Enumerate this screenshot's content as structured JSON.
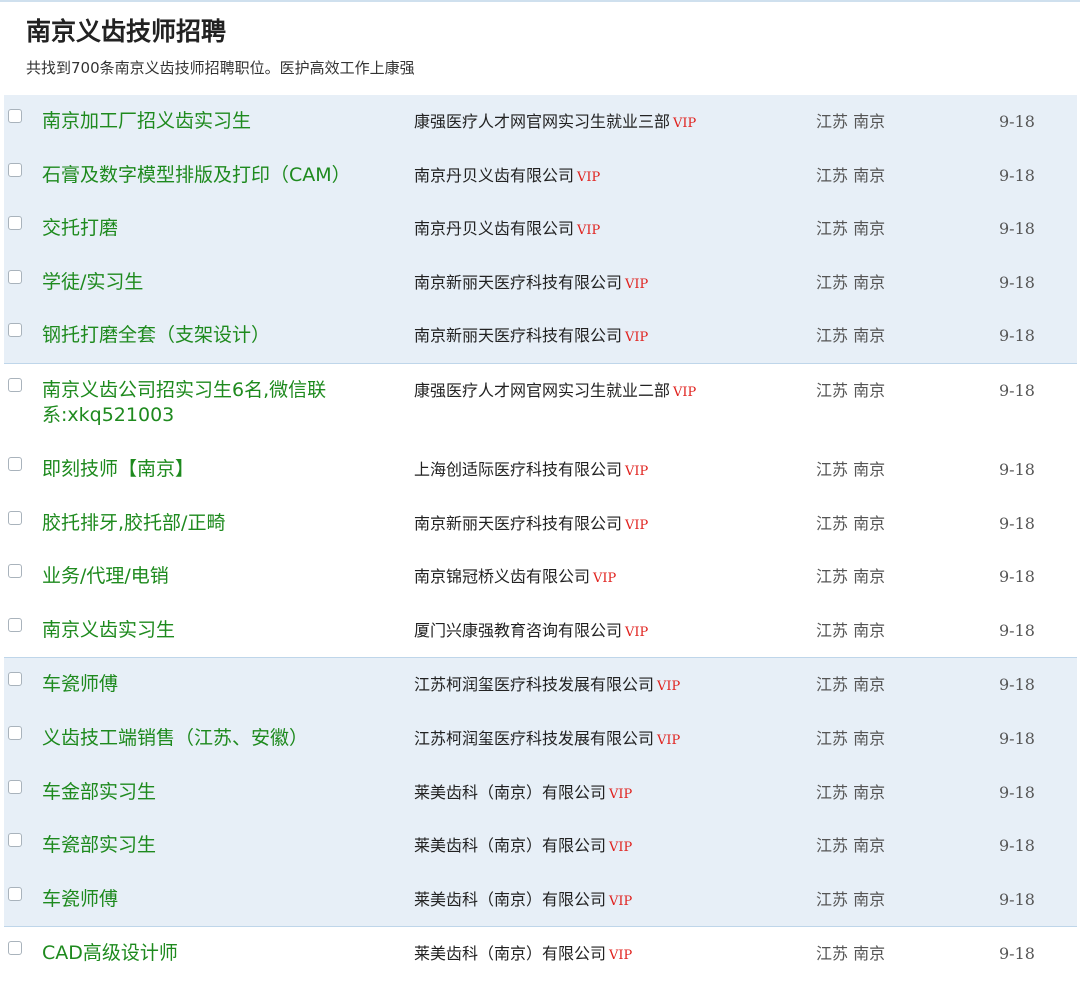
{
  "page": {
    "title": "南京义齿技师招聘",
    "summary": "共找到700条南京义齿技师招聘职位。医护高效工作上康强"
  },
  "vip_label": "VIP",
  "groups": [
    [
      {
        "title": "南京加工厂招义齿实习生",
        "company": "康强医疗人才网官网实习生就业三部",
        "location": "江苏 南京",
        "date": "9-18"
      },
      {
        "title": "石膏及数字模型排版及打印（CAM）",
        "company": "南京丹贝义齿有限公司",
        "location": "江苏 南京",
        "date": "9-18"
      },
      {
        "title": "交托打磨",
        "company": "南京丹贝义齿有限公司",
        "location": "江苏 南京",
        "date": "9-18"
      },
      {
        "title": "学徒/实习生",
        "company": "南京新丽天医疗科技有限公司",
        "location": "江苏 南京",
        "date": "9-18"
      },
      {
        "title": "钢托打磨全套（支架设计）",
        "company": "南京新丽天医疗科技有限公司",
        "location": "江苏 南京",
        "date": "9-18"
      }
    ],
    [
      {
        "title": "南京义齿公司招实习生6名,微信联系:xkq521003",
        "company": "康强医疗人才网官网实习生就业二部",
        "location": "江苏 南京",
        "date": "9-18",
        "tall": true
      },
      {
        "title": "即刻技师【南京】",
        "company": "上海创适际医疗科技有限公司",
        "location": "江苏 南京",
        "date": "9-18"
      },
      {
        "title": "胶托排牙,胶托部/正畸",
        "company": "南京新丽天医疗科技有限公司",
        "location": "江苏 南京",
        "date": "9-18"
      },
      {
        "title": "业务/代理/电销",
        "company": "南京锦冠桥义齿有限公司",
        "location": "江苏 南京",
        "date": "9-18"
      },
      {
        "title": "南京义齿实习生",
        "company": "厦门兴康强教育咨询有限公司",
        "location": "江苏 南京",
        "date": "9-18"
      }
    ],
    [
      {
        "title": "车瓷师傅",
        "company": "江苏柯润玺医疗科技发展有限公司",
        "location": "江苏 南京",
        "date": "9-18"
      },
      {
        "title": "义齿技工端销售（江苏、安徽）",
        "company": "江苏柯润玺医疗科技发展有限公司",
        "location": "江苏 南京",
        "date": "9-18"
      },
      {
        "title": "车金部实习生",
        "company": "莱美齿科（南京）有限公司",
        "location": "江苏 南京",
        "date": "9-18"
      },
      {
        "title": "车瓷部实习生",
        "company": "莱美齿科（南京）有限公司",
        "location": "江苏 南京",
        "date": "9-18"
      },
      {
        "title": "车瓷师傅",
        "company": "莱美齿科（南京）有限公司",
        "location": "江苏 南京",
        "date": "9-18"
      }
    ],
    [
      {
        "title": "CAD高级设计师",
        "company": "莱美齿科（南京）有限公司",
        "location": "江苏 南京",
        "date": "9-18"
      }
    ]
  ]
}
